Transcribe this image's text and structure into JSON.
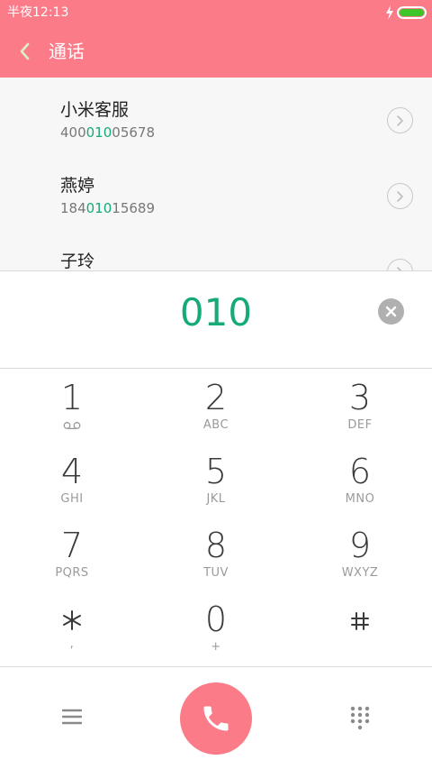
{
  "status_bar": {
    "time": "半夜12:13",
    "charging_icon": "lightning-icon",
    "battery_icon": "battery-icon",
    "battery_color": "#3ec52a"
  },
  "header": {
    "back_icon": "chevron-left-icon",
    "title": "通话",
    "background_color": "#fb7b88"
  },
  "contacts": [
    {
      "name": "小米客服",
      "number_before": "400",
      "number_match": "010",
      "number_after": "05678",
      "detail_icon": "chevron-right-circle-icon"
    },
    {
      "name": "燕婷",
      "number_before": "184",
      "number_match": "010",
      "number_after": "15689",
      "detail_icon": "chevron-right-circle-icon"
    },
    {
      "name": "子玲",
      "number_before": "",
      "number_match": "",
      "number_after": "",
      "detail_icon": "chevron-right-circle-icon"
    }
  ],
  "dialer": {
    "input": "010",
    "clear_icon": "clear-circle-icon",
    "match_color": "#16a97a",
    "keys": [
      {
        "digit": "1",
        "letters": "",
        "icon": "voicemail-icon"
      },
      {
        "digit": "2",
        "letters": "ABC"
      },
      {
        "digit": "3",
        "letters": "DEF"
      },
      {
        "digit": "4",
        "letters": "GHI"
      },
      {
        "digit": "5",
        "letters": "JKL"
      },
      {
        "digit": "6",
        "letters": "MNO"
      },
      {
        "digit": "7",
        "letters": "PQRS"
      },
      {
        "digit": "8",
        "letters": "TUV"
      },
      {
        "digit": "9",
        "letters": "WXYZ"
      },
      {
        "digit": "",
        "letters": ",",
        "icon": "asterisk-icon"
      },
      {
        "digit": "0",
        "letters": "+"
      },
      {
        "digit": "",
        "letters": "",
        "icon": "hash-icon"
      }
    ]
  },
  "bottom_bar": {
    "menu_icon": "menu-icon",
    "call_icon": "phone-icon",
    "keypad_icon": "dialpad-icon",
    "call_color": "#fb7b88"
  }
}
